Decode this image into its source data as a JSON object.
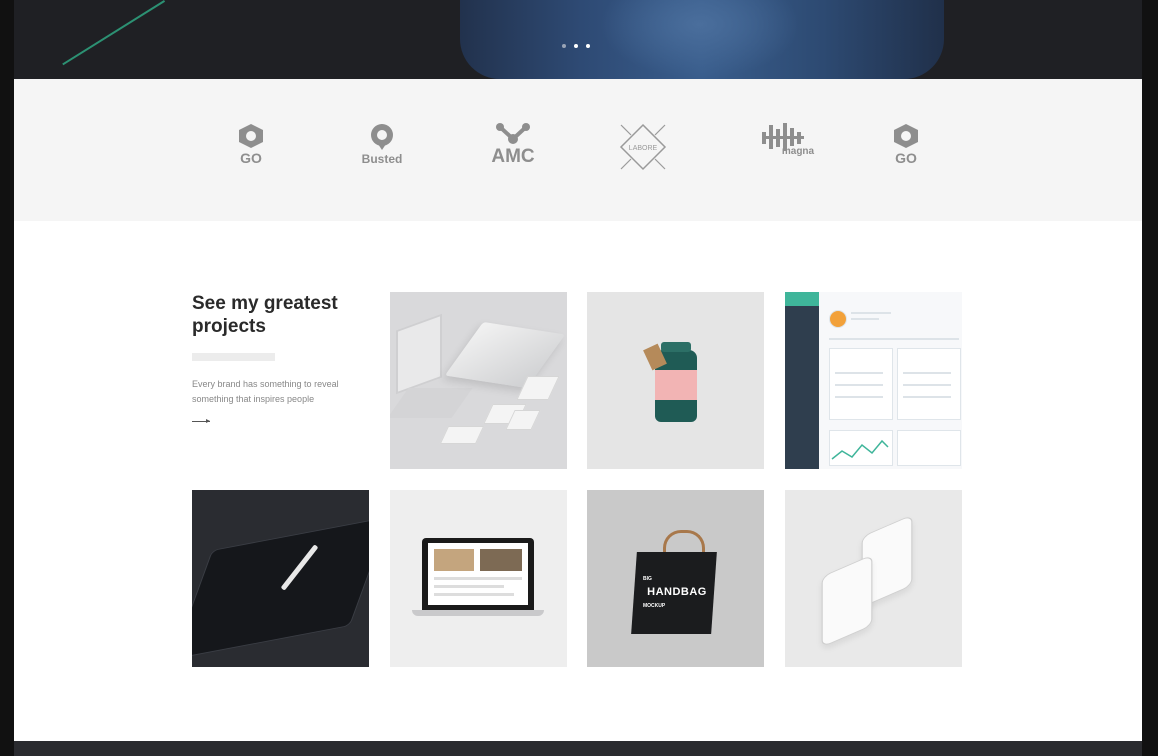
{
  "hero": {
    "slider_dots": 3,
    "active_dot": 1,
    "accent_color": "#2fae87"
  },
  "logos": [
    {
      "name": "go-logo",
      "text": "GO"
    },
    {
      "name": "busted-logo",
      "text": "Busted"
    },
    {
      "name": "amc-logo",
      "text": "AMC"
    },
    {
      "name": "labore-logo",
      "text": "LABORE"
    },
    {
      "name": "magna-logo",
      "text": "magna"
    },
    {
      "name": "go-logo-2",
      "text": "GO"
    }
  ],
  "projects": {
    "title": "See my greatest projects",
    "description": "Every brand has something to reveal something that inspires people",
    "tiles": [
      {
        "name": "stationery-mockup",
        "bg": "#d9d9db"
      },
      {
        "name": "jar-mockup",
        "bg": "#e5e5e5"
      },
      {
        "name": "dashboard-mockup",
        "bg": "#f7f8fa"
      },
      {
        "name": "ipad-pencil-mockup",
        "bg": "#2a2c31"
      },
      {
        "name": "macbook-mockup",
        "bg": "#eeeeee"
      },
      {
        "name": "handbag-mockup",
        "bg": "#c9c9c9"
      },
      {
        "name": "iphone-mockup",
        "bg": "#e9e9e9"
      }
    ]
  },
  "handbag": {
    "line1": "BIG",
    "line2": "HANDBAG",
    "line3": "MOCKUP"
  }
}
